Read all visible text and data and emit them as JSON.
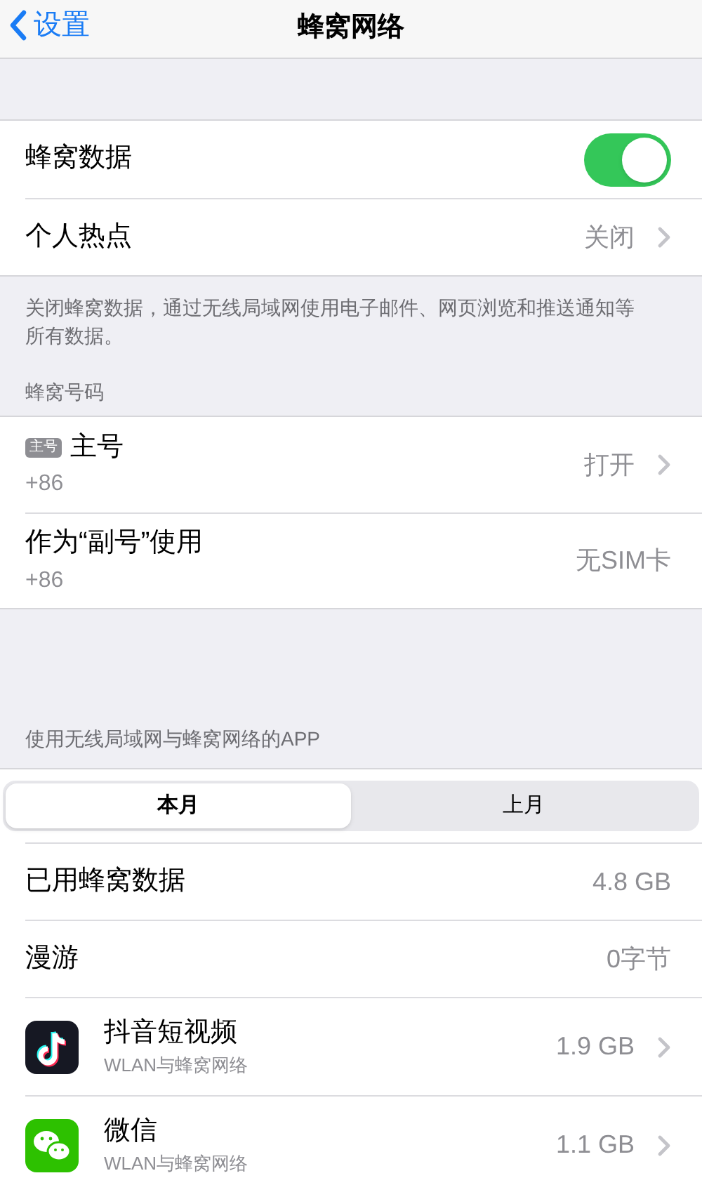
{
  "nav": {
    "back": "设置",
    "title": "蜂窝网络"
  },
  "main_section": {
    "rows": [
      {
        "kind": "toggle",
        "label": "蜂窝数据",
        "on": true
      },
      {
        "kind": "disclosure",
        "label": "个人热点",
        "value": "关闭"
      }
    ],
    "footer": "关闭蜂窝数据，通过无线局域网使用电子邮件、网页浏览和推送通知等所有数据。"
  },
  "numbers_section": {
    "header": "蜂窝号码",
    "rows": [
      {
        "badge": "主号",
        "label": "主号",
        "number": "+86",
        "value": "打开",
        "chevron": true
      },
      {
        "label": "作为“副号”使用",
        "number": "+86",
        "value": "无SIM卡",
        "chevron": false
      }
    ]
  },
  "usage_section": {
    "header": "使用无线局域网与蜂窝网络的APP",
    "segments": [
      {
        "label": "本月",
        "selected": true
      },
      {
        "label": "上月",
        "selected": false
      }
    ],
    "rows": [
      {
        "kind": "value",
        "label": "已用蜂窝数据",
        "value": "4.8 GB"
      },
      {
        "kind": "value",
        "label": "漫游",
        "value": "0字节"
      },
      {
        "kind": "video_app",
        "label": "抖音短视频",
        "subtitle": "WLAN与蜂窝网络",
        "value": "1.9 GB"
      },
      {
        "kind": "chat_app",
        "label": "微信",
        "subtitle": "WLAN与蜂窝网络",
        "value": "1.1 GB"
      }
    ]
  }
}
